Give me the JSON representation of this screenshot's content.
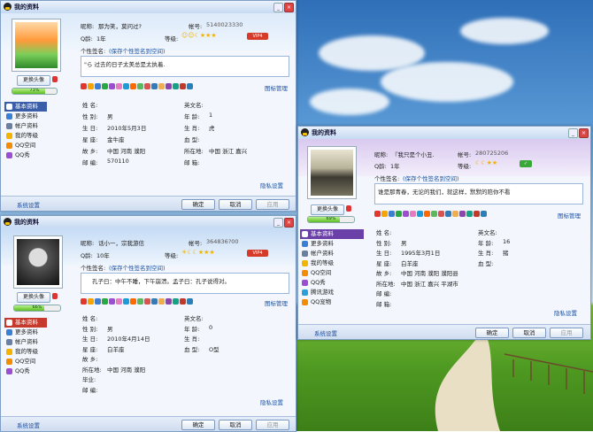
{
  "w1": {
    "title": "我的资料",
    "nick_label": "昵称:",
    "nick": "那为笑，莫问过?",
    "acct_label": "帐号:",
    "acct": "5140023330",
    "age_label": "Q龄:",
    "age": "1年",
    "level_label": "等级:",
    "sig_label": "个性签名:",
    "sig_hint": "(保存个性签名到空间)",
    "sig": "\"ら 过去的日子太美总是太执着.",
    "modify_avatar": "更换头像",
    "level_pct": "73%",
    "side": [
      "基本资料",
      "更多资料",
      "帐户资料",
      "我的等级",
      "QQ空间",
      "QQ秀"
    ],
    "show_manage": "图标管理",
    "fields": [
      {
        "l": "姓 名:",
        "v": ""
      },
      {
        "l": "英文名:",
        "v": ""
      },
      {
        "l": "性 别:",
        "v": "男"
      },
      {
        "l": "年 龄:",
        "v": "1"
      },
      {
        "l": "生 日:",
        "v": "2010年5月3日"
      },
      {
        "l": "生 肖:",
        "v": "虎"
      },
      {
        "l": "星 座:",
        "v": "金牛座"
      },
      {
        "l": "血 型:",
        "v": ""
      },
      {
        "l": "故 乡:",
        "v": "中国 河南 濮阳"
      },
      {
        "l": "所在地:",
        "v": "中国 浙江 嘉兴"
      },
      {
        "l": "邮 编:",
        "v": "570110"
      },
      {
        "l": "邮 箱:",
        "v": ""
      }
    ],
    "hidden_set": "隐私设置",
    "sys_set": "系统设置",
    "ok": "确定",
    "cancel": "取消",
    "apply": "应用"
  },
  "w2": {
    "title": "我的资料",
    "nick_label": "昵称:",
    "nick": "话小一，宗我游信",
    "acct_label": "帐号:",
    "acct": "364836?00",
    "age_label": "Q龄:",
    "age": "10年",
    "level_label": "等级:",
    "sig_label": "个性签名:",
    "sig_hint": "(保存个性签名到空间)",
    "sig": "孔子曰：中午不睡，下午崩溃。孟子曰：孔子说得对。",
    "modify_avatar": "更换头像",
    "level_pct": "66%",
    "side": [
      "基本资料",
      "更多资料",
      "帐户资料",
      "我的等级",
      "QQ空间",
      "QQ秀"
    ],
    "show_manage": "图标管理",
    "fields": [
      {
        "l": "姓 名:",
        "v": ""
      },
      {
        "l": "英文名:",
        "v": ""
      },
      {
        "l": "性 别:",
        "v": "男"
      },
      {
        "l": "年 龄:",
        "v": "0"
      },
      {
        "l": "生 日:",
        "v": "2010年4月14日"
      },
      {
        "l": "生 肖:",
        "v": ""
      },
      {
        "l": "星 座:",
        "v": "白羊座"
      },
      {
        "l": "血 型:",
        "v": "O型"
      },
      {
        "l": "故 乡:",
        "v": ""
      },
      {
        "l": "",
        "v": ""
      },
      {
        "l": "所在地:",
        "v": "中国 河南 濮阳"
      },
      {
        "l": "",
        "v": ""
      },
      {
        "l": "毕业:",
        "v": ""
      },
      {
        "l": "",
        "v": ""
      },
      {
        "l": "邮 编:",
        "v": ""
      },
      {
        "l": "",
        "v": ""
      }
    ],
    "hidden_set": "隐私设置",
    "sys_set": "系统设置",
    "ok": "确定",
    "cancel": "取消",
    "apply": "应用"
  },
  "w3": {
    "title": "我的资料",
    "nick_label": "昵称:",
    "nick": "『我只是个小丑.",
    "acct_label": "帐号:",
    "acct": "280725206",
    "age_label": "Q龄:",
    "age": "1年",
    "level_label": "等级:",
    "sig_label": "个性签名:",
    "sig_hint": "(保存个性签名到空间)",
    "sig": "谁是那青春，无论的我们，就这样，默默的陪你不看",
    "modify_avatar": "更换头像",
    "level_pct": "69%",
    "side": [
      "基本资料",
      "更多资料",
      "帐户资料",
      "我的等级",
      "QQ空间",
      "QQ秀",
      "腾讯游戏",
      "QQ宠物"
    ],
    "show_manage": "图标管理",
    "fields": [
      {
        "l": "姓 名:",
        "v": ""
      },
      {
        "l": "英文名:",
        "v": ""
      },
      {
        "l": "性 别:",
        "v": "男"
      },
      {
        "l": "年 龄:",
        "v": "16"
      },
      {
        "l": "生 日:",
        "v": "1995年3月1日"
      },
      {
        "l": "生 肖:",
        "v": "猪"
      },
      {
        "l": "星 座:",
        "v": "白羊座"
      },
      {
        "l": "血 型:",
        "v": ""
      },
      {
        "l": "故 乡:",
        "v": "中国 河南 濮阳 濮阳县"
      },
      {
        "l": "",
        "v": ""
      },
      {
        "l": "所在地:",
        "v": "中国 浙江 嘉兴 平湖市"
      },
      {
        "l": "",
        "v": ""
      },
      {
        "l": "邮 编:",
        "v": ""
      },
      {
        "l": "",
        "v": ""
      },
      {
        "l": "邮 箱:",
        "v": ""
      },
      {
        "l": "",
        "v": ""
      }
    ],
    "hidden_set": "隐私设置",
    "sys_set": "系统设置",
    "ok": "确定",
    "cancel": "取消",
    "apply": "应用"
  },
  "icon_colors": [
    "#e2372d",
    "#f7a400",
    "#3a7fd4",
    "#28a745",
    "#9b4fd0",
    "#e57cc2",
    "#1e9bd7",
    "#ff6a00",
    "#5cb85c",
    "#d9534f",
    "#337ab7",
    "#f0ad4e",
    "#8e44ad",
    "#16a085",
    "#c0392b",
    "#2980b9"
  ]
}
